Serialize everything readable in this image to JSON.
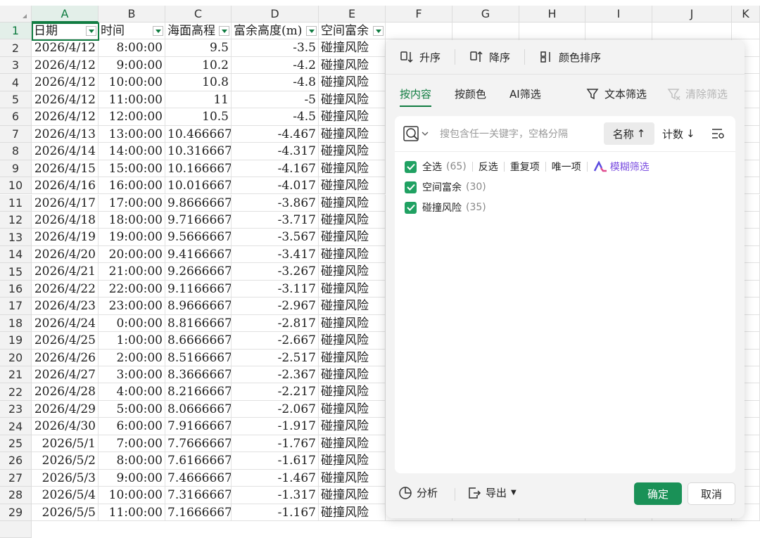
{
  "columns": [
    "A",
    "B",
    "C",
    "D",
    "E",
    "F",
    "G",
    "H",
    "I",
    "J",
    "K"
  ],
  "header_cells": [
    "日期",
    "时间",
    "海面高程",
    "富余高度(m)",
    "空间富余"
  ],
  "rows": [
    {
      "n": "2",
      "a": "2026/4/12",
      "b": "8:00:00",
      "c": "9.5",
      "d": "-3.5",
      "e": "碰撞风险"
    },
    {
      "n": "3",
      "a": "2026/4/12",
      "b": "9:00:00",
      "c": "10.2",
      "d": "-4.2",
      "e": "碰撞风险"
    },
    {
      "n": "4",
      "a": "2026/4/12",
      "b": "10:00:00",
      "c": "10.8",
      "d": "-4.8",
      "e": "碰撞风险"
    },
    {
      "n": "5",
      "a": "2026/4/12",
      "b": "11:00:00",
      "c": "11",
      "d": "-5",
      "e": "碰撞风险"
    },
    {
      "n": "6",
      "a": "2026/4/12",
      "b": "12:00:00",
      "c": "10.5",
      "d": "-4.5",
      "e": "碰撞风险"
    },
    {
      "n": "7",
      "a": "2026/4/13",
      "b": "13:00:00",
      "c": "10.466667",
      "d": "-4.467",
      "e": "碰撞风险"
    },
    {
      "n": "8",
      "a": "2026/4/14",
      "b": "14:00:00",
      "c": "10.316667",
      "d": "-4.317",
      "e": "碰撞风险"
    },
    {
      "n": "9",
      "a": "2026/4/15",
      "b": "15:00:00",
      "c": "10.166667",
      "d": "-4.167",
      "e": "碰撞风险"
    },
    {
      "n": "10",
      "a": "2026/4/16",
      "b": "16:00:00",
      "c": "10.016667",
      "d": "-4.017",
      "e": "碰撞风险"
    },
    {
      "n": "11",
      "a": "2026/4/17",
      "b": "17:00:00",
      "c": "9.8666667",
      "d": "-3.867",
      "e": "碰撞风险"
    },
    {
      "n": "12",
      "a": "2026/4/18",
      "b": "18:00:00",
      "c": "9.7166667",
      "d": "-3.717",
      "e": "碰撞风险"
    },
    {
      "n": "13",
      "a": "2026/4/19",
      "b": "19:00:00",
      "c": "9.5666667",
      "d": "-3.567",
      "e": "碰撞风险"
    },
    {
      "n": "14",
      "a": "2026/4/20",
      "b": "20:00:00",
      "c": "9.4166667",
      "d": "-3.417",
      "e": "碰撞风险"
    },
    {
      "n": "15",
      "a": "2026/4/21",
      "b": "21:00:00",
      "c": "9.2666667",
      "d": "-3.267",
      "e": "碰撞风险"
    },
    {
      "n": "16",
      "a": "2026/4/22",
      "b": "22:00:00",
      "c": "9.1166667",
      "d": "-3.117",
      "e": "碰撞风险"
    },
    {
      "n": "17",
      "a": "2026/4/23",
      "b": "23:00:00",
      "c": "8.9666667",
      "d": "-2.967",
      "e": "碰撞风险"
    },
    {
      "n": "18",
      "a": "2026/4/24",
      "b": "0:00:00",
      "c": "8.8166667",
      "d": "-2.817",
      "e": "碰撞风险"
    },
    {
      "n": "19",
      "a": "2026/4/25",
      "b": "1:00:00",
      "c": "8.6666667",
      "d": "-2.667",
      "e": "碰撞风险"
    },
    {
      "n": "20",
      "a": "2026/4/26",
      "b": "2:00:00",
      "c": "8.5166667",
      "d": "-2.517",
      "e": "碰撞风险"
    },
    {
      "n": "21",
      "a": "2026/4/27",
      "b": "3:00:00",
      "c": "8.3666667",
      "d": "-2.367",
      "e": "碰撞风险"
    },
    {
      "n": "22",
      "a": "2026/4/28",
      "b": "4:00:00",
      "c": "8.2166667",
      "d": "-2.217",
      "e": "碰撞风险"
    },
    {
      "n": "23",
      "a": "2026/4/29",
      "b": "5:00:00",
      "c": "8.0666667",
      "d": "-2.067",
      "e": "碰撞风险"
    },
    {
      "n": "24",
      "a": "2026/4/30",
      "b": "6:00:00",
      "c": "7.9166667",
      "d": "-1.917",
      "e": "碰撞风险"
    },
    {
      "n": "25",
      "a": "2026/5/1",
      "b": "7:00:00",
      "c": "7.7666667",
      "d": "-1.767",
      "e": "碰撞风险"
    },
    {
      "n": "26",
      "a": "2026/5/2",
      "b": "8:00:00",
      "c": "7.6166667",
      "d": "-1.617",
      "e": "碰撞风险"
    },
    {
      "n": "27",
      "a": "2026/5/3",
      "b": "9:00:00",
      "c": "7.4666667",
      "d": "-1.467",
      "e": "碰撞风险"
    },
    {
      "n": "28",
      "a": "2026/5/4",
      "b": "10:00:00",
      "c": "7.3166667",
      "d": "-1.317",
      "e": "碰撞风险"
    },
    {
      "n": "29",
      "a": "2026/5/5",
      "b": "11:00:00",
      "c": "7.1666667",
      "d": "-1.167",
      "e": "碰撞风险"
    }
  ],
  "filter_panel": {
    "sort_asc": "升序",
    "sort_desc": "降序",
    "sort_color": "颜色排序",
    "tabs": [
      "按内容",
      "按颜色",
      "AI筛选"
    ],
    "text_filter": "文本筛选",
    "clear_filter": "清除筛选",
    "search_placeholder": "搜包含任一关键字，空格分隔",
    "sort_name": "名称",
    "sort_count": "计数",
    "select_all": "全选",
    "select_all_count": "(65)",
    "invert": "反选",
    "duplicates": "重复项",
    "unique": "唯一项",
    "fuzzy": "模糊筛选",
    "items": [
      {
        "label": "空间富余",
        "count": "(30)"
      },
      {
        "label": "碰撞风险",
        "count": "(35)"
      }
    ],
    "analyze": "分析",
    "export": "导出",
    "ok": "确定",
    "cancel": "取消"
  }
}
